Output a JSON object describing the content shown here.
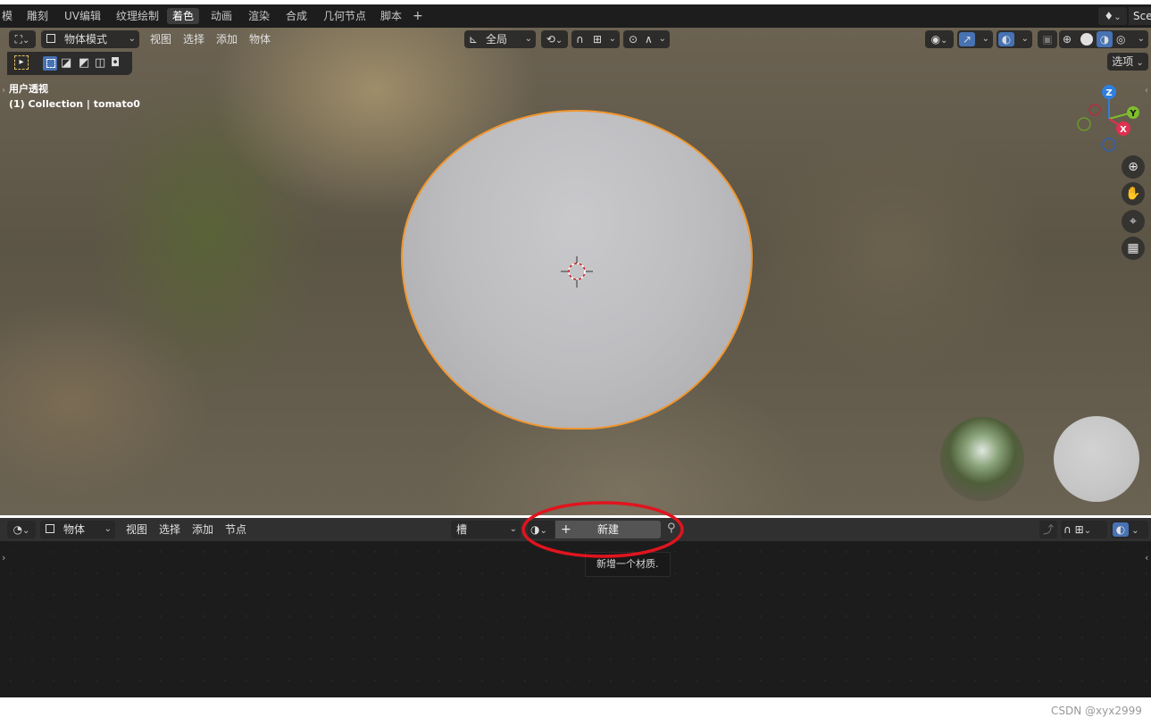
{
  "topbar": {
    "tabs": [
      "模",
      "雕刻",
      "UV编辑",
      "纹理绘制",
      "着色",
      "动画",
      "渲染",
      "合成",
      "几何节点",
      "脚本"
    ],
    "active_tab": "着色",
    "add_label": "+",
    "scene_label": "Sce"
  },
  "viewport_header": {
    "mode": "物体模式",
    "menus": [
      "视图",
      "选择",
      "添加",
      "物体"
    ],
    "transform_orientation": "全局",
    "options_label": "选项"
  },
  "viewport_overlay": {
    "view_name": "用户透视",
    "collection_info": "(1) Collection | tomato0"
  },
  "gizmo": {
    "z": "Z",
    "y": "Y",
    "x": "X"
  },
  "node_header": {
    "type": "物体",
    "menus": [
      "视图",
      "选择",
      "添加",
      "节点"
    ],
    "slot_label": "槽",
    "new_label": "新建",
    "new_plus": "+"
  },
  "tooltip": {
    "text": "新增一个材质."
  },
  "watermark": "CSDN @xyx2999",
  "colors": {
    "accent_blue": "#4772b3",
    "selection_orange": "#f0962e",
    "annotation_red": "#e0141e"
  }
}
